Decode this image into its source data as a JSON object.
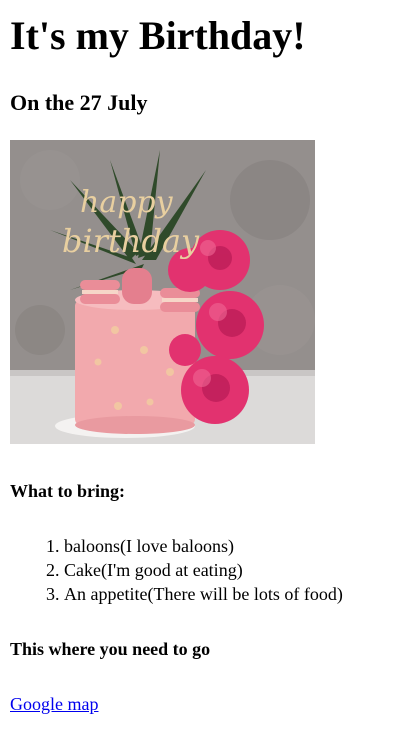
{
  "page": {
    "title": "It's my Birthday!",
    "date_line": "On the 27 July",
    "photo": {
      "topper_line1": "happy",
      "topper_line2": "birthday",
      "colors": {
        "background_wall": "#8d8886",
        "table": "#dcdad9",
        "cake": "#f2a9ad",
        "roses": "#e2326f",
        "macarons": "#ea8d98",
        "topper": "#e8cfa0",
        "leaves": "#2f4a2a"
      }
    },
    "bring_heading": "What to bring:",
    "bring_items": [
      "baloons(I love baloons)",
      "Cake(I'm good at eating)",
      "An appetite(There will be lots of food)"
    ],
    "directions_heading": "This where you need to go",
    "map_link_label": "Google map",
    "link_color": "#0000ee"
  }
}
